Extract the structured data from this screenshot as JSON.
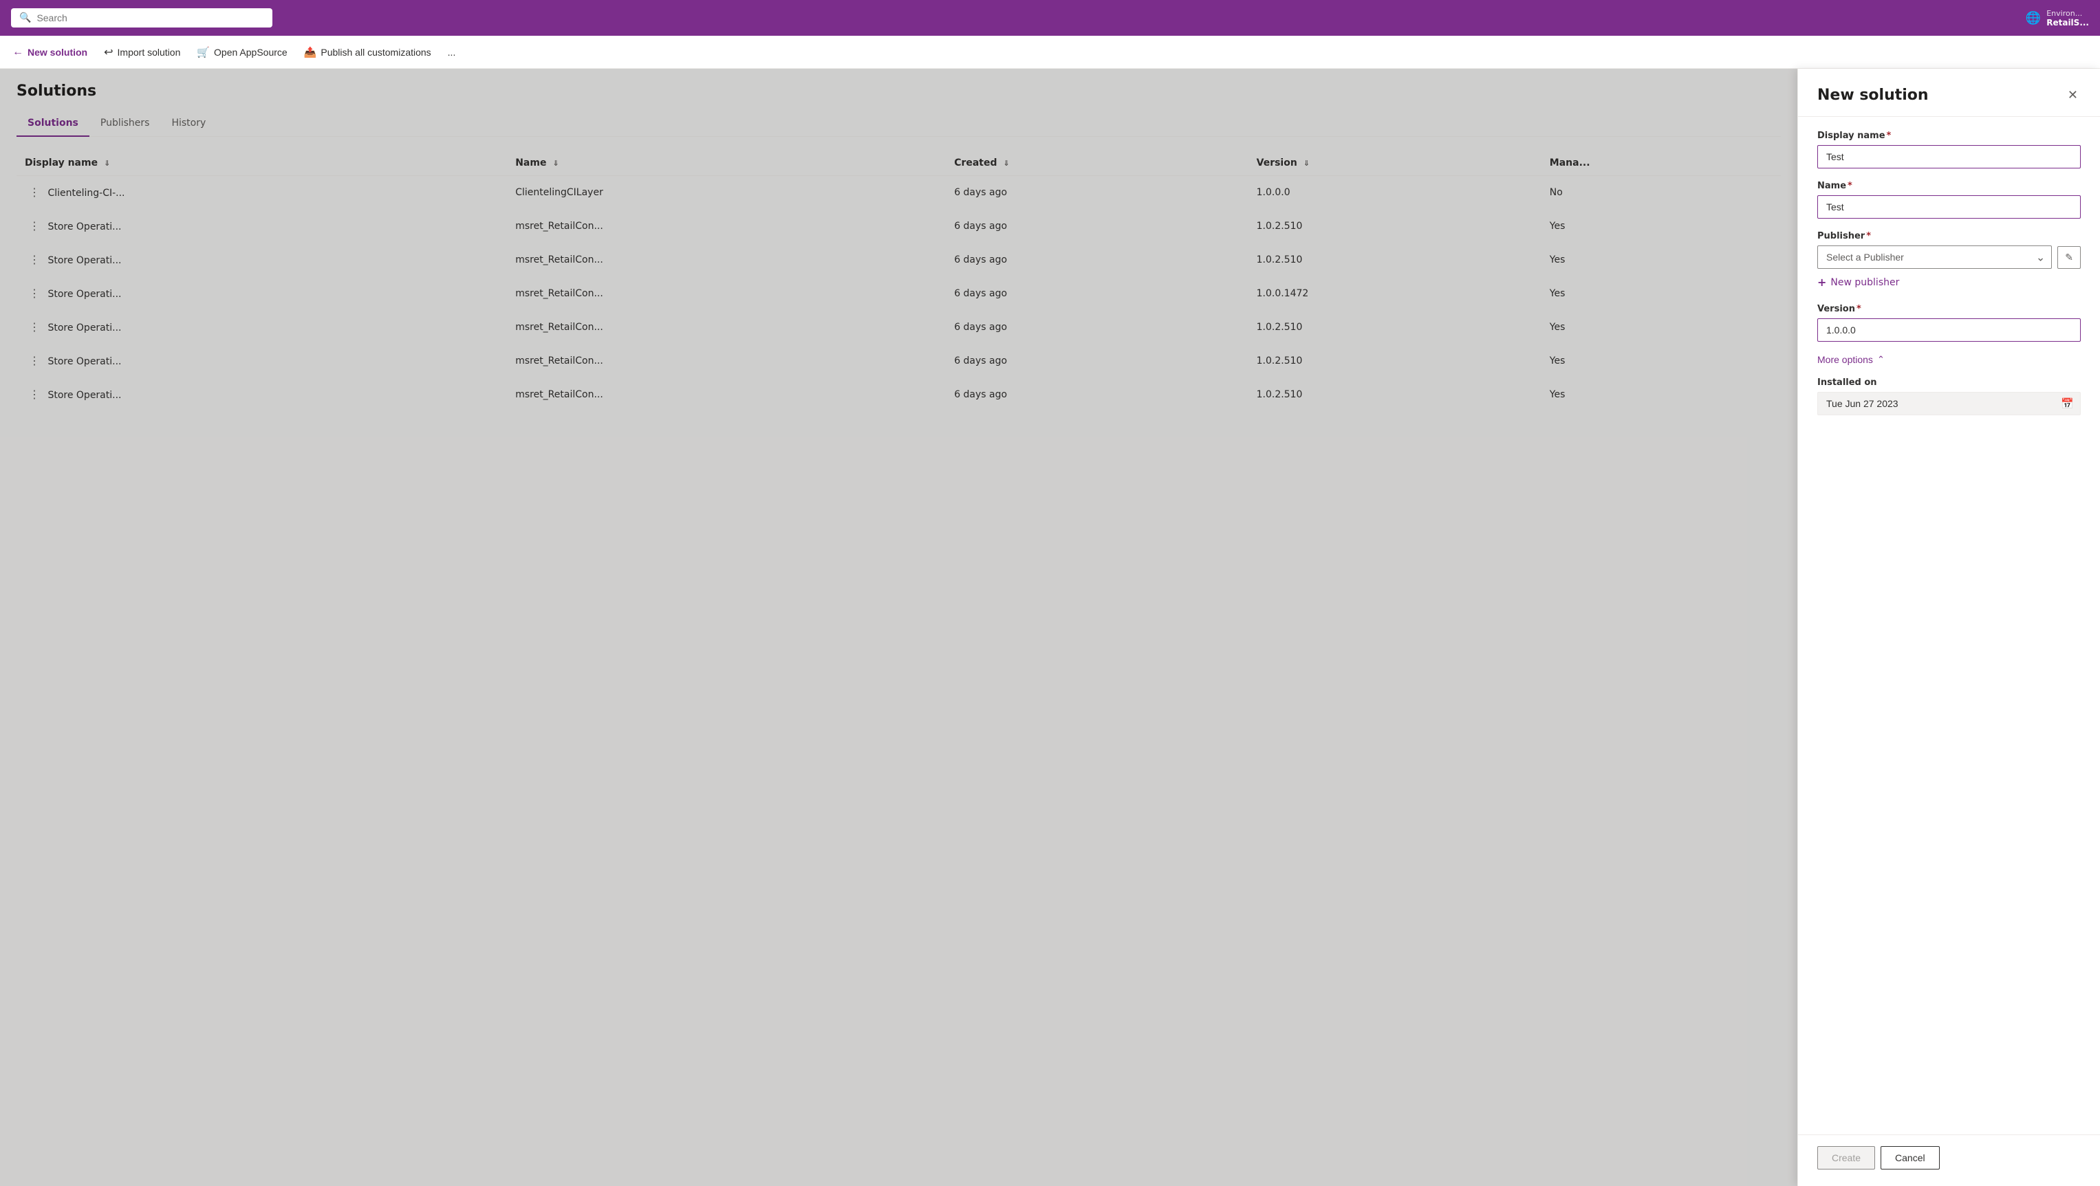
{
  "topbar": {
    "search_placeholder": "Search",
    "env_label": "Environ...",
    "env_sub": "RetailS..."
  },
  "toolbar": {
    "new_solution": "New solution",
    "import_solution": "Import solution",
    "open_appsource": "Open AppSource",
    "publish_all": "Publish all customizations",
    "more": "..."
  },
  "page": {
    "title": "Solutions"
  },
  "tabs": [
    {
      "id": "solutions",
      "label": "Solutions",
      "active": true
    },
    {
      "id": "publishers",
      "label": "Publishers",
      "active": false
    },
    {
      "id": "history",
      "label": "History",
      "active": false
    }
  ],
  "table": {
    "columns": [
      {
        "id": "display_name",
        "label": "Display name",
        "sortable": true
      },
      {
        "id": "name",
        "label": "Name",
        "sortable": true
      },
      {
        "id": "created",
        "label": "Created",
        "sortable": true,
        "sorted": true
      },
      {
        "id": "version",
        "label": "Version",
        "sortable": true
      },
      {
        "id": "managed",
        "label": "Mana..."
      }
    ],
    "rows": [
      {
        "display_name": "Clienteling-CI-...",
        "name": "ClientelingCILayer",
        "created": "6 days ago",
        "version": "1.0.0.0",
        "managed": "No"
      },
      {
        "display_name": "Store Operati...",
        "name": "msret_RetailCon...",
        "created": "6 days ago",
        "version": "1.0.2.510",
        "managed": "Yes"
      },
      {
        "display_name": "Store Operati...",
        "name": "msret_RetailCon...",
        "created": "6 days ago",
        "version": "1.0.2.510",
        "managed": "Yes"
      },
      {
        "display_name": "Store Operati...",
        "name": "msret_RetailCon...",
        "created": "6 days ago",
        "version": "1.0.0.1472",
        "managed": "Yes"
      },
      {
        "display_name": "Store Operati...",
        "name": "msret_RetailCon...",
        "created": "6 days ago",
        "version": "1.0.2.510",
        "managed": "Yes"
      },
      {
        "display_name": "Store Operati...",
        "name": "msret_RetailCon...",
        "created": "6 days ago",
        "version": "1.0.2.510",
        "managed": "Yes"
      },
      {
        "display_name": "Store Operati...",
        "name": "msret_RetailCon...",
        "created": "6 days ago",
        "version": "1.0.2.510",
        "managed": "Yes"
      }
    ]
  },
  "side_panel": {
    "title": "New solution",
    "display_name_label": "Display name",
    "display_name_value": "Test",
    "name_label": "Name",
    "name_value": "Test",
    "publisher_label": "Publisher",
    "publisher_placeholder": "Select a Publisher",
    "new_publisher_label": "New publisher",
    "version_label": "Version",
    "version_value": "1.0.0.0",
    "more_options_label": "More options",
    "installed_on_label": "Installed on",
    "installed_on_value": "Tue Jun 27 2023",
    "create_label": "Create",
    "cancel_label": "Cancel"
  },
  "icons": {
    "search": "🔍",
    "globe": "🌐",
    "new_solution": "←",
    "import": "↵",
    "store": "🏪",
    "publish": "📤",
    "close": "✕",
    "chevron_down": "∨",
    "pencil": "✏",
    "plus": "+",
    "chevron_up": "∧",
    "calendar": "📅"
  }
}
